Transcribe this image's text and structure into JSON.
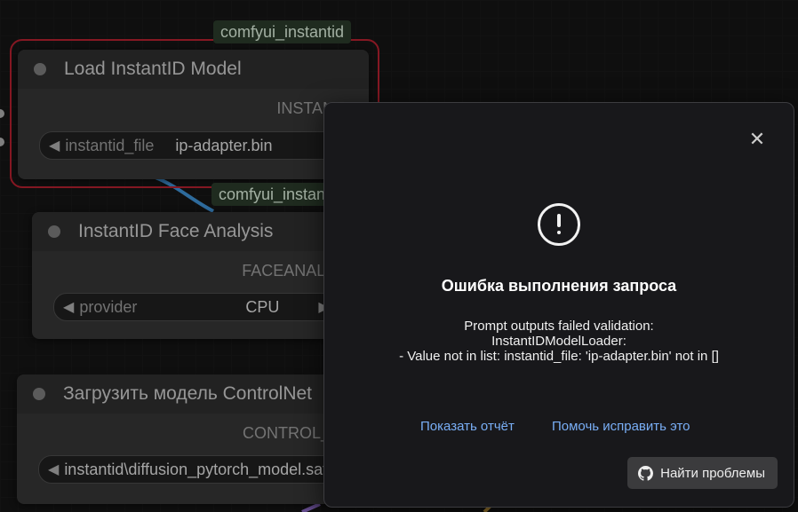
{
  "nodes": [
    {
      "group": "comfyui_instantid",
      "title": "Load InstantID Model",
      "output": "INSTANTID",
      "widget": {
        "name": "instantid_file",
        "value": "ip-adapter.bin"
      }
    },
    {
      "group": "comfyui_instantid",
      "title": "InstantID Face Analysis",
      "output": "FACEANALYSIS",
      "widget": {
        "name": "provider",
        "value": "CPU"
      }
    },
    {
      "title": "Загрузить модель ControlNet",
      "output": "CONTROL_NET",
      "widget": {
        "name": "",
        "value": "instantid\\diffusion_pytorch_model.safetensors"
      }
    }
  ],
  "dialog": {
    "title": "Ошибка выполнения запроса",
    "message_lines": [
      "Prompt outputs failed validation:",
      "InstantIDModelLoader:",
      "- Value not in list: instantid_file: 'ip-adapter.bin' not in []"
    ],
    "report_link": "Показать отчёт",
    "help_link": "Помочь исправить это",
    "find_issues_button": "Найти проблемы",
    "close_icon": "close-icon",
    "error_icon": "exclamation-circle-icon",
    "github_icon": "github-icon"
  },
  "colors": {
    "selection_outline": "#b3202f",
    "group_tag_bg": "#2a3a2a",
    "link_color": "#79aef5"
  }
}
